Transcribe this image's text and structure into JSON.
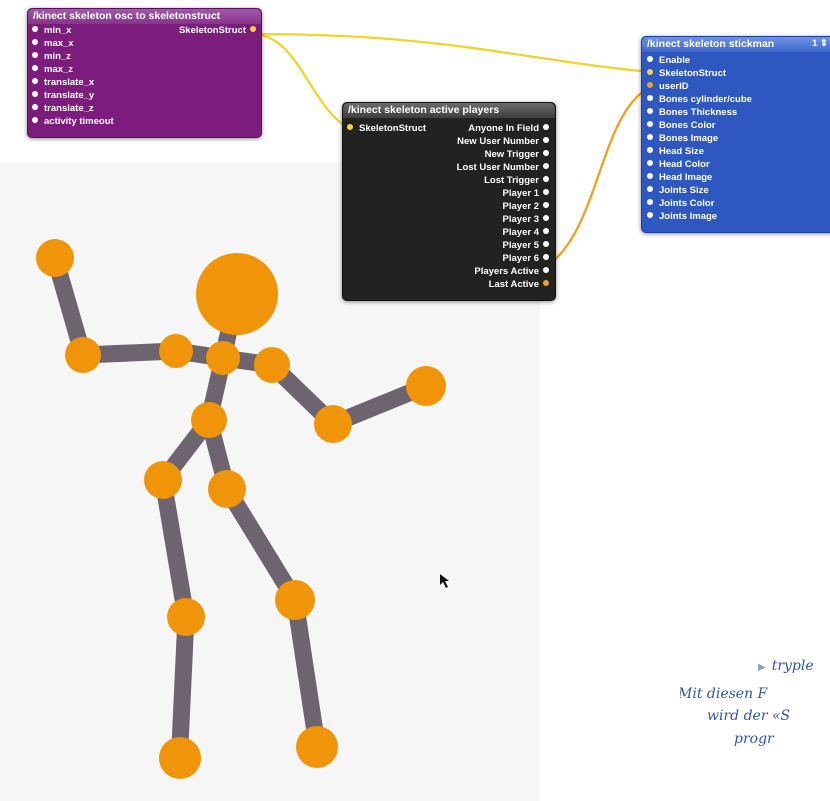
{
  "patches": {
    "osc": {
      "title": "/kinect skeleton osc to skeletonstruct",
      "inputs": [
        "min_x",
        "max_x",
        "min_z",
        "max_z",
        "translate_x",
        "translate_y",
        "translate_z",
        "activity timeout"
      ],
      "outputs": [
        "SkeletonStruct"
      ]
    },
    "active": {
      "title": "/kinect skeleton active players",
      "inputs": [
        "SkeletonStruct"
      ],
      "outputs": [
        "Anyone In Field",
        "New User Number",
        "New Trigger",
        "Lost User Number",
        "Lost Trigger",
        "Player 1",
        "Player 2",
        "Player 3",
        "Player 4",
        "Player 5",
        "Player 6",
        "Players Active",
        "Last Active"
      ]
    },
    "stickman": {
      "title": "/kinect skeleton stickman",
      "badge": "1 ⇕",
      "inputs": [
        "Enable",
        "SkeletonStruct",
        "userID",
        "Bones cylinder/cube",
        "Bones Thickness",
        "Bones Color",
        "Bones Image",
        "Head Size",
        "Head Color",
        "Head Image",
        "Joints Size",
        "Joints Color",
        "Joints Image"
      ]
    }
  },
  "colors": {
    "osc_patch": "#7c1d7e",
    "active_patch": "#222321",
    "stickman_patch": "#2f57c0",
    "wire_yellow": "#f2d32a",
    "wire_orange": "#f0a020",
    "bone": "#6e6470",
    "joint": "#f0950a"
  },
  "caption": {
    "link": "tryple",
    "line2": "Mit diesen F",
    "line3": "wird der «S",
    "line4": "progr"
  },
  "icons": [
    "cursor-arrow-icon",
    "disclosure-triangle-icon"
  ]
}
